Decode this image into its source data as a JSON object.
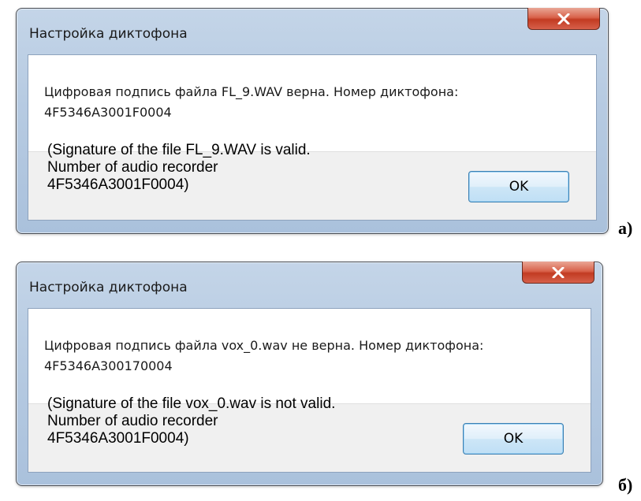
{
  "dialogs": [
    {
      "title": "Настройка диктофона",
      "message": "Цифровая подпись файла FL_9.WAV верна. Номер диктофона: 4F5346A3001F0004",
      "translation": "(Signature of the file FL_9.WAV is valid. Number of audio recorder 4F5346A3001F0004)",
      "ok_label": "OK",
      "close_icon": "close-x-icon",
      "caption": "а)"
    },
    {
      "title": "Настройка диктофона",
      "message": "Цифровая подпись файла vox_0.wav не верна. Номер диктофона: 4F5346A300170004",
      "translation": "(Signature of the file vox_0.wav is not valid. Number of audio recorder 4F5346A3001F0004)",
      "ok_label": "OK",
      "close_icon": "close-x-icon",
      "caption": "б)"
    }
  ],
  "colors": {
    "close_button": "#c8412a",
    "ok_border": "#3c7fb1",
    "frame": "#b7cbe2"
  }
}
